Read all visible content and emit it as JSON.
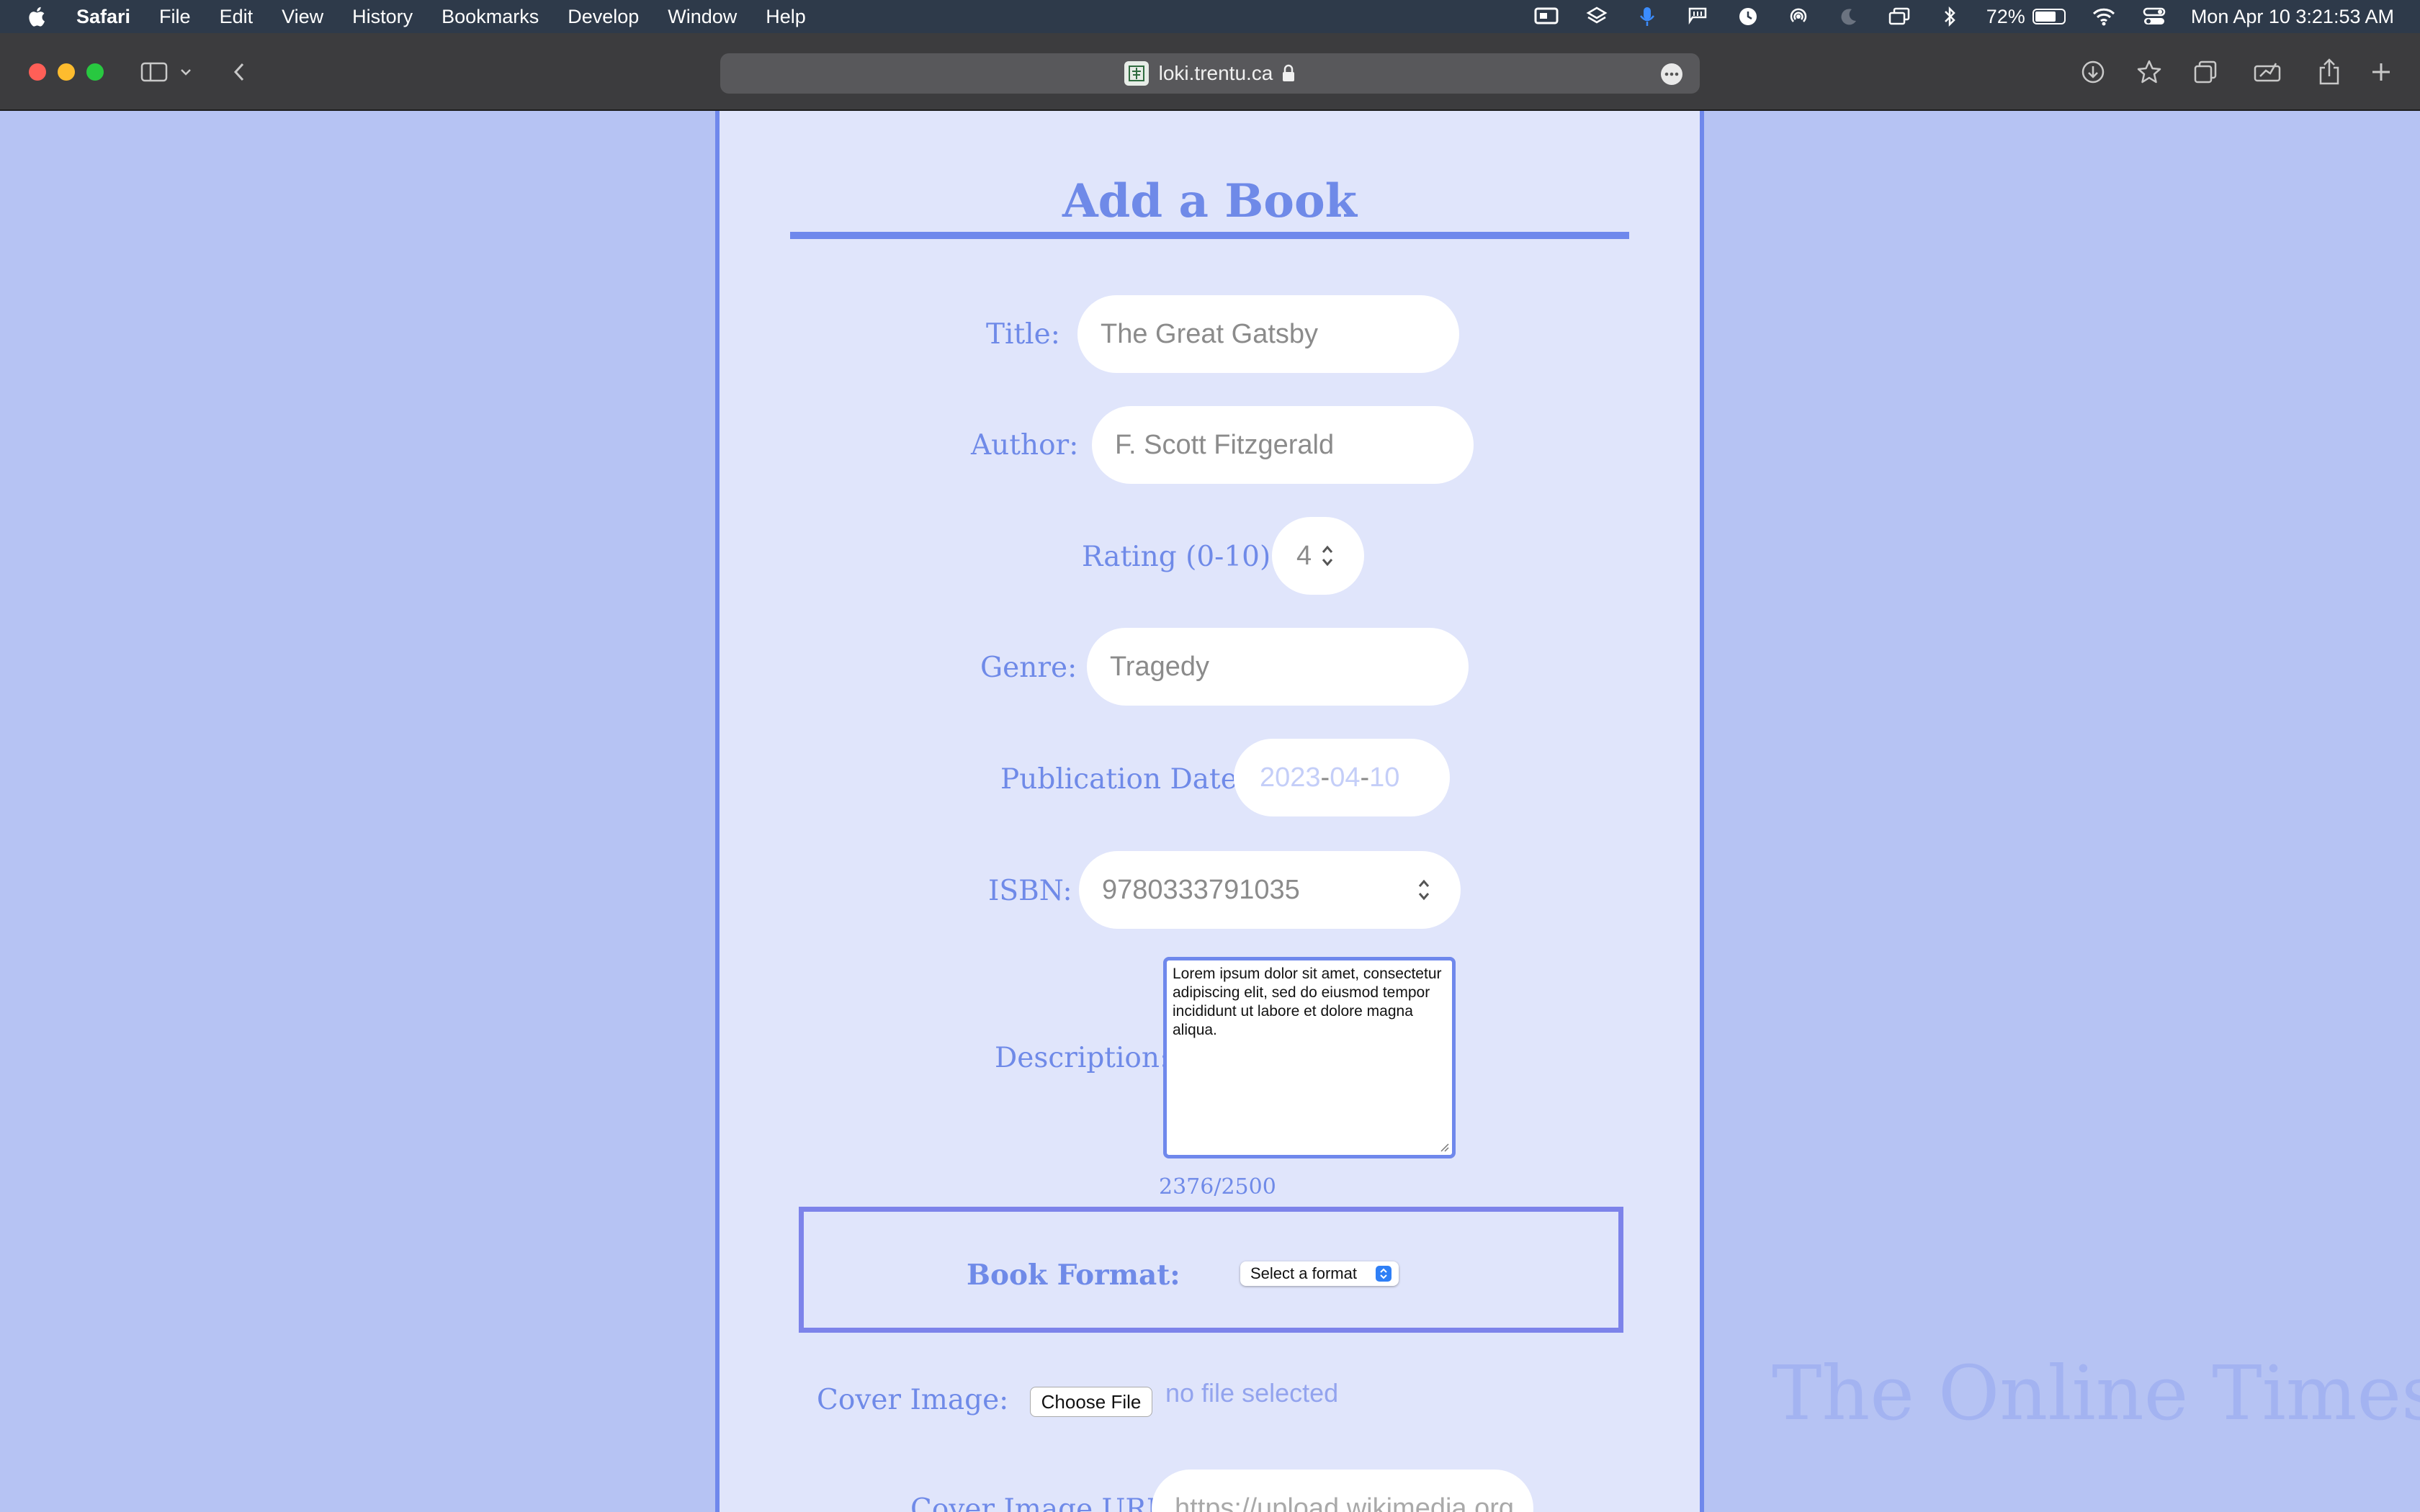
{
  "menubar": {
    "app": "Safari",
    "items": [
      "File",
      "Edit",
      "View",
      "History",
      "Bookmarks",
      "Develop",
      "Window",
      "Help"
    ],
    "battery_percent": "72%",
    "datetime": "Mon Apr 10  3:21:53 AM",
    "status_icons": [
      "screen-mirror-icon",
      "layers-icon",
      "microphone-icon",
      "flag-icon",
      "clock-icon",
      "airdrop-icon",
      "moon-icon",
      "windows-icon",
      "bluetooth-icon",
      "battery-icon",
      "wifi-icon",
      "control-center-icon"
    ]
  },
  "browser": {
    "url": "loki.trentu.ca",
    "toolbar_icons": [
      "sidebar-icon",
      "chevron-down-icon",
      "back-icon",
      "download-icon",
      "star-icon",
      "tabs-icon",
      "reader-icon",
      "share-icon",
      "new-tab-icon"
    ]
  },
  "form": {
    "heading": "Add a Book",
    "title_label": "Title:",
    "title_value": "The Great Gatsby",
    "author_label": "Author:",
    "author_value": "F. Scott Fitzgerald",
    "rating_label": "Rating (0-10):",
    "rating_value": "4",
    "genre_label": "Genre:",
    "genre_value": "Tragedy",
    "pubdate_label": "Publication Date:",
    "pubdate_year": "2023",
    "pubdate_month": "04",
    "pubdate_day": "10",
    "isbn_label": "ISBN:",
    "isbn_value": "9780333791035",
    "description_label": "Description:",
    "description_value": "Lorem ipsum dolor sit amet, consectetur adipiscing elit, sed do eiusmod tempor incididunt ut labore et dolore magna aliqua.",
    "char_counter": "2376/2500",
    "format_label": "Book Format:",
    "format_selected": "Select a format",
    "cover_label": "Cover Image:",
    "choose_file": "Choose File",
    "no_file": "no file selected",
    "cover_url_label": "Cover Image URL:",
    "cover_url_placeholder": "https://upload.wikimedia.org"
  },
  "watermark": "The Online Times",
  "colors": {
    "accent": "#6f88ec",
    "panel": "#e0e5fb",
    "background": "#b6c3f3",
    "label": "#6f8ae8"
  }
}
